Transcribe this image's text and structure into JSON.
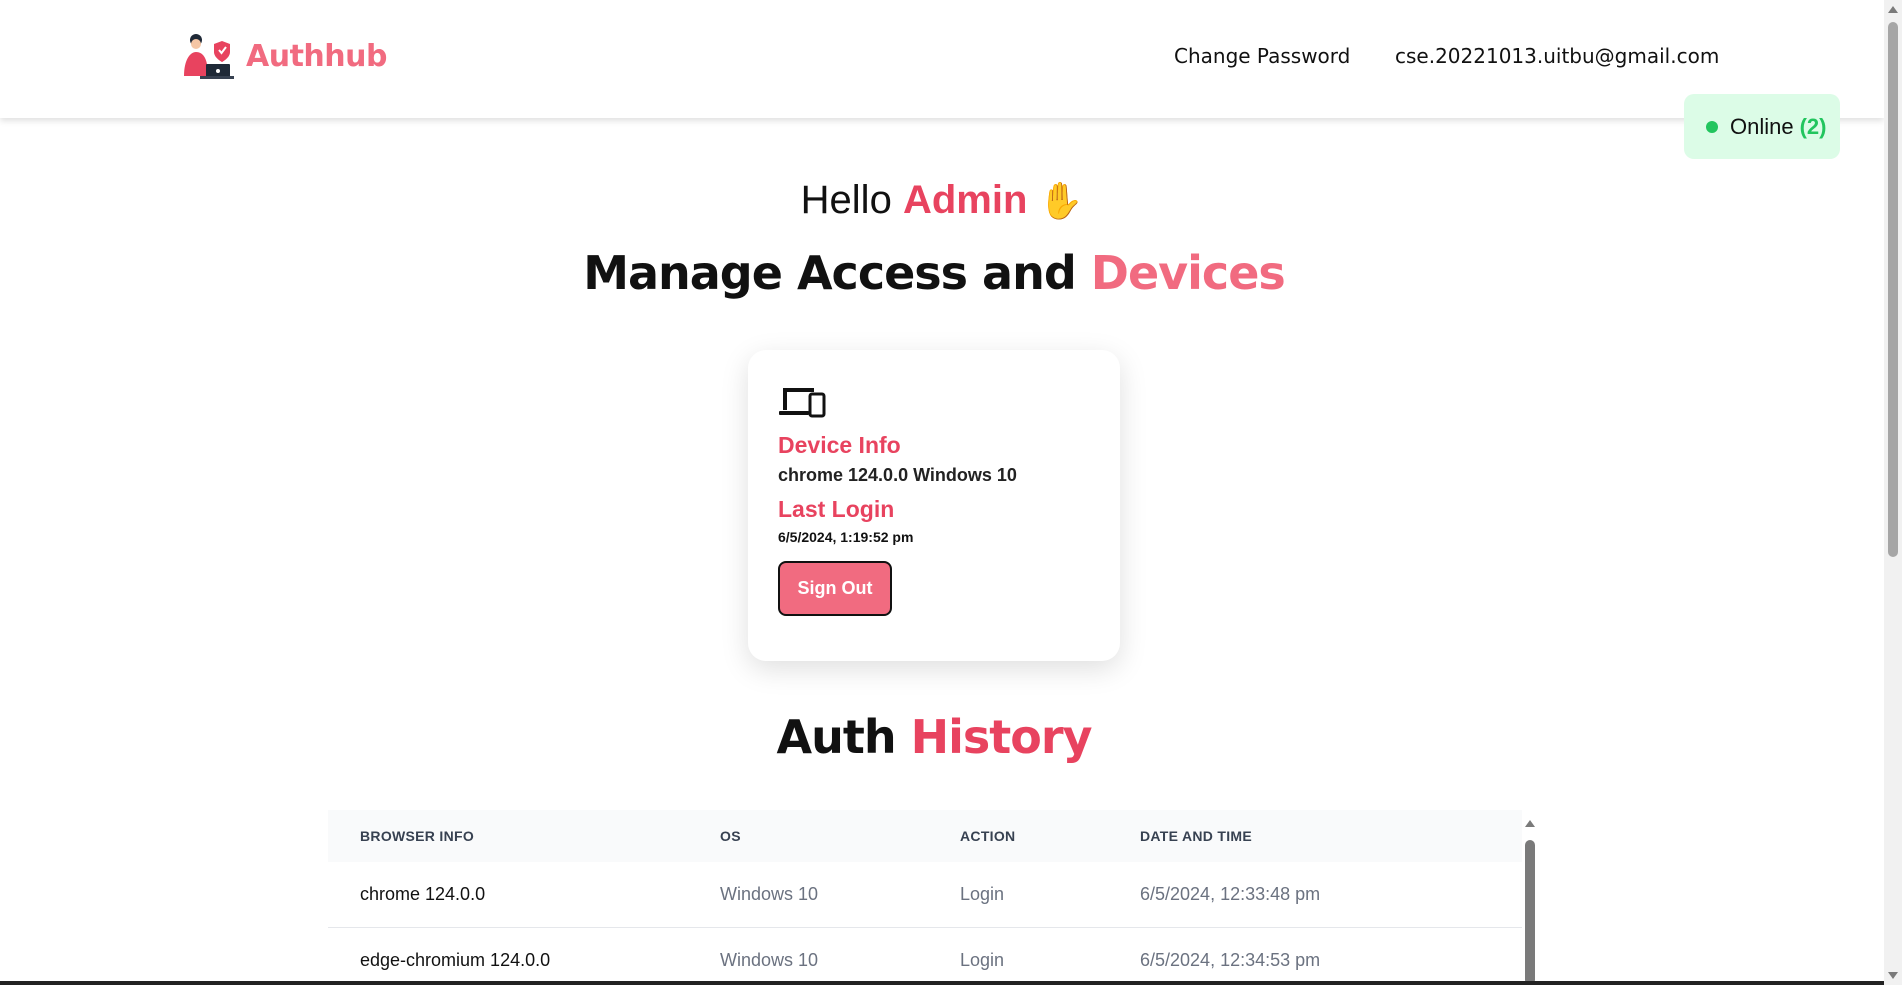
{
  "brand": {
    "name": "Authhub"
  },
  "nav": {
    "change_password": "Change Password",
    "email": "cse.20221013.uitbu@gmail.com"
  },
  "status": {
    "label": "Online",
    "count": "(2)",
    "color": "#22c55e"
  },
  "greeting": {
    "prefix": "Hello",
    "name": "Admin",
    "emoji": "✋"
  },
  "title": {
    "main": "Manage Access and",
    "accent": "Devices"
  },
  "device_card": {
    "device_info_label": "Device Info",
    "device_info_value": "chrome 124.0.0 Windows 10",
    "last_login_label": "Last Login",
    "last_login_value": "6/5/2024, 1:19:52 pm",
    "sign_out_label": "Sign Out"
  },
  "history": {
    "title_main": "Auth",
    "title_accent": "History",
    "columns": [
      "BROWSER INFO",
      "OS",
      "ACTION",
      "DATE AND TIME"
    ],
    "rows": [
      {
        "browser": "chrome 124.0.0",
        "os": "Windows 10",
        "action": "Login",
        "datetime": "6/5/2024, 12:33:48 pm"
      },
      {
        "browser": "edge-chromium 124.0.0",
        "os": "Windows 10",
        "action": "Login",
        "datetime": "6/5/2024, 12:34:53 pm"
      }
    ]
  },
  "colors": {
    "accent": "#e8435f",
    "accent_light": "#f16b80",
    "online_bg": "#dcfce7"
  }
}
